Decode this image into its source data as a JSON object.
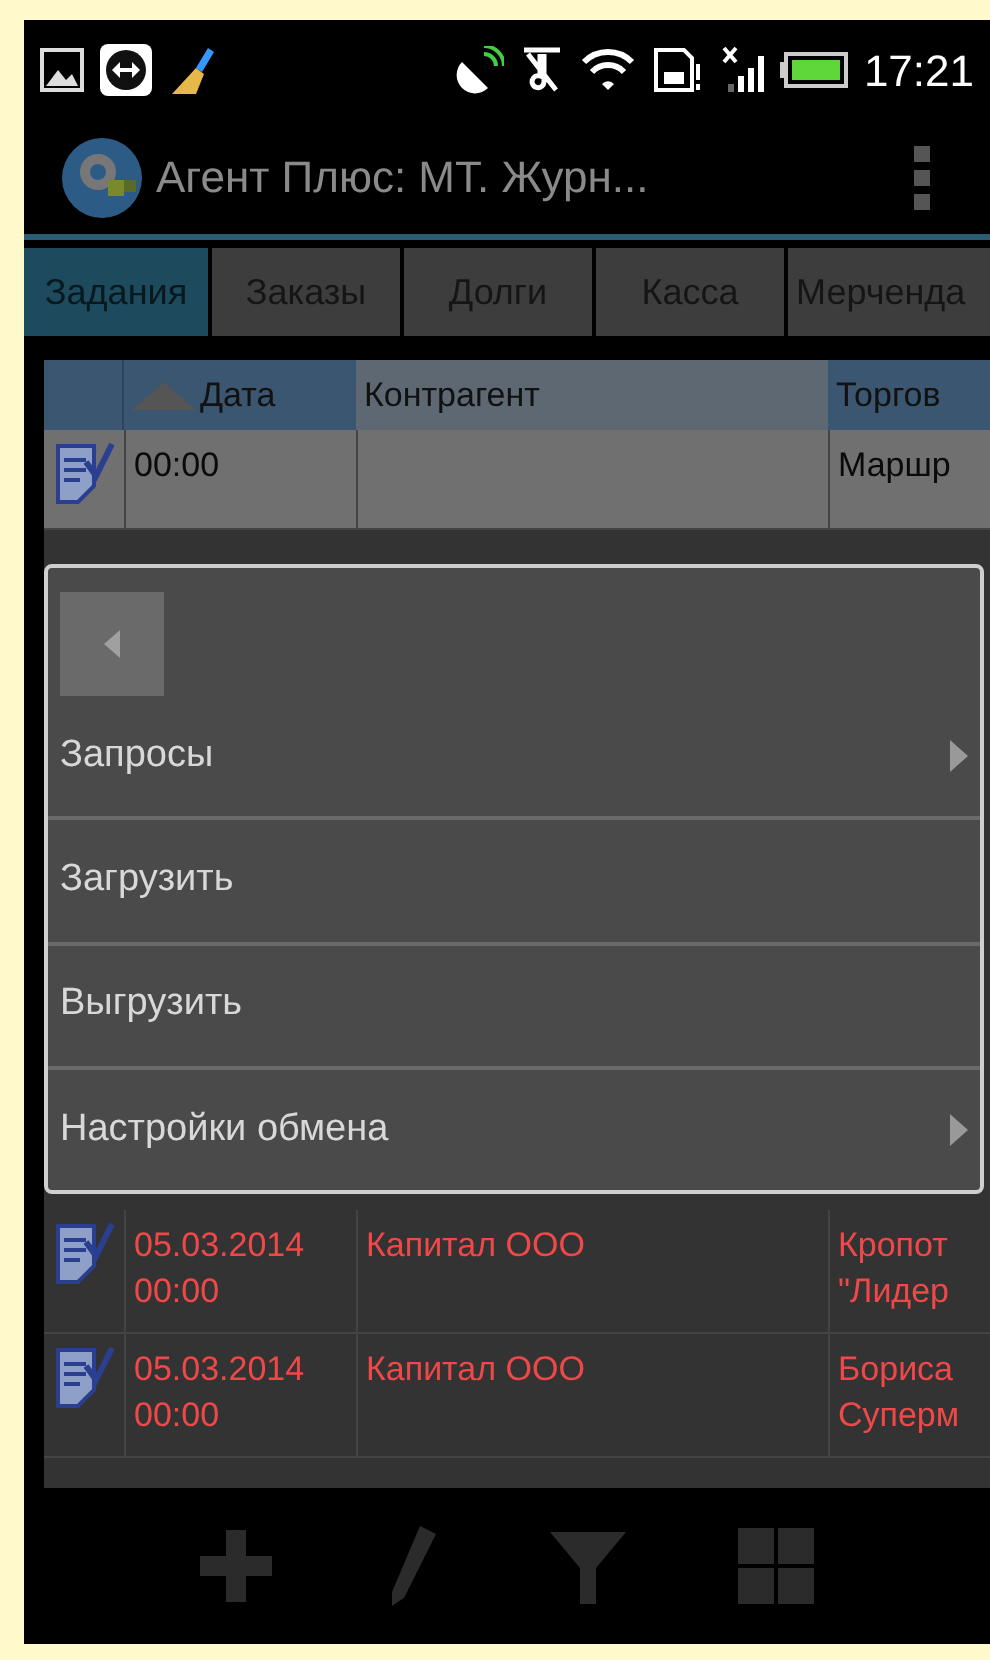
{
  "status_bar": {
    "time": "17:21"
  },
  "action_bar": {
    "title": "Агент Плюс: МТ. Журн..."
  },
  "tabs": [
    {
      "label": "Задания",
      "selected": true
    },
    {
      "label": "Заказы",
      "selected": false
    },
    {
      "label": "Долги",
      "selected": false
    },
    {
      "label": "Касса",
      "selected": false
    },
    {
      "label": "Мерченда",
      "selected": false
    }
  ],
  "table": {
    "columns": [
      {
        "label": "Дата",
        "sorted": true
      },
      {
        "label": "Контрагент",
        "sorted": false
      },
      {
        "label": "Торгов",
        "sorted": false
      }
    ],
    "rows_top": [
      {
        "date": "00:00",
        "column_3": "Маршр",
        "overdue": false
      }
    ],
    "rows_bottom": [
      {
        "date": "05.03.2014\n00:00",
        "counterparty": "Капитал ООО",
        "column_3": "Кропот\n\"Лидер",
        "overdue": true
      },
      {
        "date": "05.03.2014\n00:00",
        "counterparty": "Капитал ООО",
        "column_3": "Бориса\nСуперм",
        "overdue": true
      }
    ]
  },
  "menu": {
    "items": [
      {
        "label": "Запросы",
        "has_submenu": true
      },
      {
        "label": "Загрузить",
        "has_submenu": false
      },
      {
        "label": "Выгрузить",
        "has_submenu": false
      },
      {
        "label": "Настройки обмена",
        "has_submenu": true
      }
    ]
  }
}
